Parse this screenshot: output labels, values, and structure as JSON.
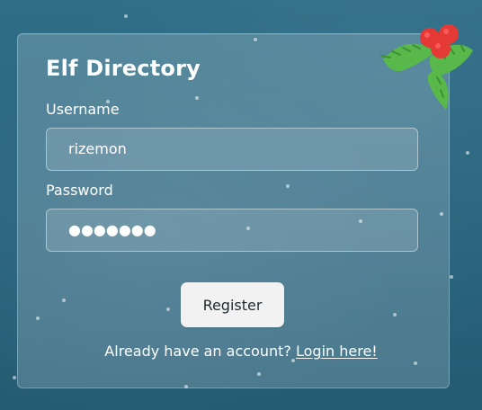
{
  "form": {
    "title": "Elf Directory",
    "username_label": "Username",
    "username_value": "rizemon",
    "password_label": "Password",
    "password_masked": "●●●●●●●",
    "register_label": "Register",
    "login_prompt": "Already have an account?",
    "login_link": "Login here!"
  },
  "icons": {
    "holly": "holly-icon"
  },
  "colors": {
    "background": "#2a6680",
    "card": "rgba(255,255,255,0.18)",
    "text": "#ffffff",
    "button": "#f2f2f2",
    "berry": "#e53935",
    "leaf": "#58b84a"
  }
}
